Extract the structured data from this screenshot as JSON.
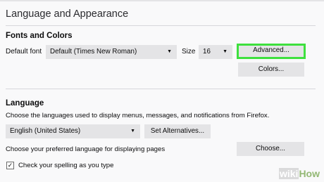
{
  "page": {
    "title": "Language and Appearance"
  },
  "fonts_colors": {
    "title": "Fonts and Colors",
    "default_font_label": "Default font",
    "default_font_value": "Default (Times New Roman)",
    "size_label": "Size",
    "size_value": "16",
    "advanced_label": "Advanced...",
    "colors_label": "Colors..."
  },
  "language": {
    "title": "Language",
    "description": "Choose the languages used to display menus, messages, and notifications from Firefox.",
    "language_value": "English (United States)",
    "set_alternatives_label": "Set Alternatives...",
    "page_language_label": "Choose your preferred language for displaying pages",
    "choose_label": "Choose...",
    "spelling_label": "Check your spelling as you type",
    "spelling_checked": true
  },
  "watermark": {
    "wiki": "wiki",
    "how": "How"
  },
  "colors": {
    "highlight": "#3ee03e",
    "control_bg": "#e4e4e6"
  },
  "icons": {
    "dropdown": "chevron-down-icon",
    "check": "checkmark-icon"
  }
}
